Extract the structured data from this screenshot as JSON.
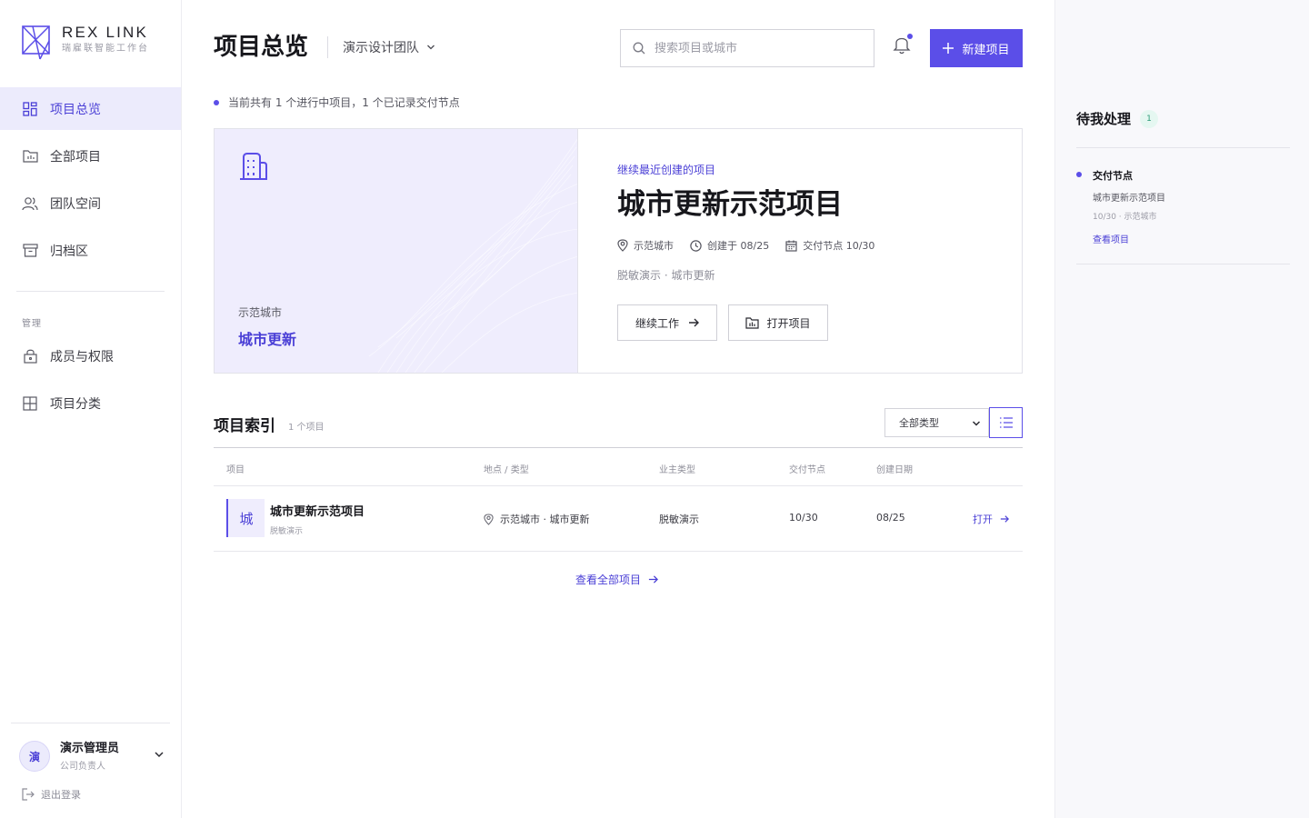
{
  "brand": {
    "name": "REX LINK",
    "subtitle": "瑞雇联智能工作台"
  },
  "sidebar": {
    "items": [
      {
        "label": "项目总览",
        "icon": "grid-icon",
        "active": true
      },
      {
        "label": "全部项目",
        "icon": "folder-icon"
      },
      {
        "label": "团队空间",
        "icon": "users-icon"
      },
      {
        "label": "归档区",
        "icon": "archive-icon"
      }
    ],
    "section_label": "管理",
    "manage_items": [
      {
        "label": "成员与权限",
        "icon": "lock-icon"
      },
      {
        "label": "项目分类",
        "icon": "grid-squares-icon"
      }
    ]
  },
  "user": {
    "avatar_char": "演",
    "name": "演示管理员",
    "role": "公司负责人",
    "logout_label": "退出登录"
  },
  "header": {
    "title": "项目总览",
    "team": "演示设计团队",
    "search_placeholder": "搜索项目或城市",
    "new_button": "新建项目"
  },
  "status_line": "当前共有 1 个进行中项目，1 个已记录交付节点",
  "hero": {
    "city": "示范城市",
    "category": "城市更新",
    "eyebrow": "继续最近创建的项目",
    "title": "城市更新示范项目",
    "meta_location": "示范城市",
    "meta_created": "创建于 08/25",
    "meta_delivery": "交付节点 10/30",
    "tags": "脱敏演示 · 城市更新",
    "continue_button": "继续工作",
    "open_button": "打开项目"
  },
  "index": {
    "title": "项目索引",
    "count": "1 个项目",
    "filter_selected": "全部类型",
    "columns": [
      "项目",
      "地点 / 类型",
      "业主类型",
      "交付节点",
      "创建日期"
    ],
    "rows": [
      {
        "thumb": "城",
        "name": "城市更新示范项目",
        "sub": "脱敏演示",
        "location": "示范城市 · 城市更新",
        "owner_type": "脱敏演示",
        "delivery": "10/30",
        "created": "08/25",
        "action": "打开"
      }
    ],
    "view_all": "查看全部项目"
  },
  "todo": {
    "title": "待我处理",
    "count": "1",
    "item": {
      "title": "交付节点",
      "project": "城市更新示范项目",
      "meta": "10/30 · 示范城市",
      "link": "查看项目"
    }
  },
  "colors": {
    "accent": "#5b4ee8",
    "accent_light": "#efedfd",
    "badge_bg": "#e5f7f1",
    "badge_text": "#2d9a78"
  }
}
